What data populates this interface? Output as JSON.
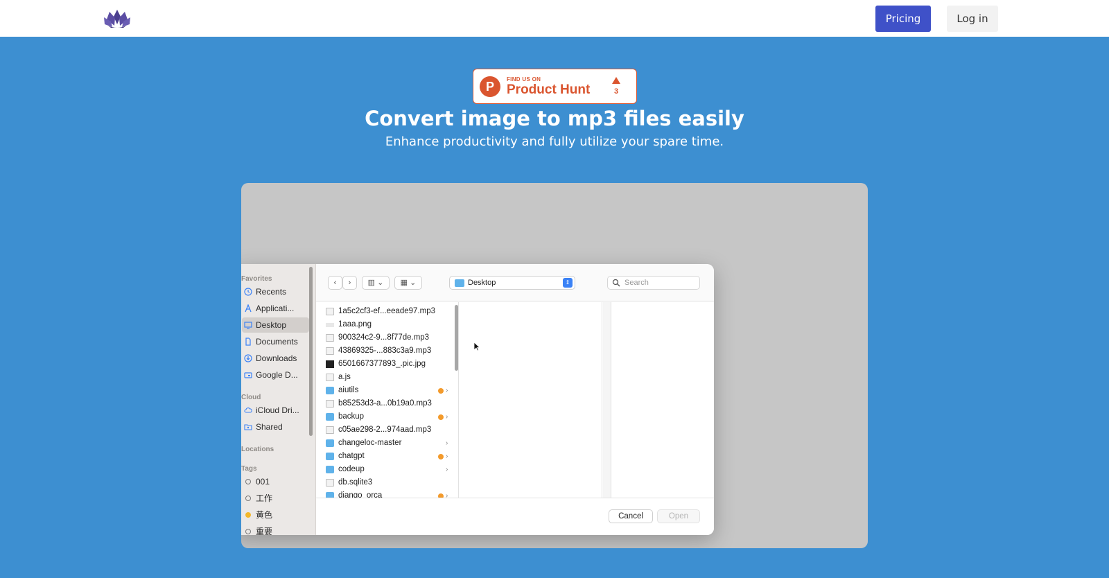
{
  "nav": {
    "pricing_label": "Pricing",
    "login_label": "Log in",
    "brand_color": "#3f51c8"
  },
  "hero": {
    "badge_small": "FIND US ON",
    "badge_big": "Product Hunt",
    "badge_count": "3",
    "title": "Convert image to mp3 files easily",
    "subtitle": "Enhance productivity and fully utilize your spare time.",
    "background_color": "#3d8fd1"
  },
  "dialog": {
    "sidebar": {
      "headings": {
        "favorites": "Favorites",
        "cloud": "Cloud",
        "locations": "Locations",
        "tags": "Tags"
      },
      "favorites": [
        {
          "label": "Recents",
          "icon": "clock-icon"
        },
        {
          "label": "Applicati...",
          "icon": "apps-icon"
        },
        {
          "label": "Desktop",
          "icon": "desktop-icon",
          "selected": true
        },
        {
          "label": "Documents",
          "icon": "document-icon"
        },
        {
          "label": "Downloads",
          "icon": "download-icon"
        },
        {
          "label": "Google D...",
          "icon": "drive-icon"
        }
      ],
      "cloud": [
        {
          "label": "iCloud Dri...",
          "icon": "cloud-icon"
        },
        {
          "label": "Shared",
          "icon": "shared-folder-icon"
        }
      ],
      "tags": [
        {
          "label": "001",
          "color": ""
        },
        {
          "label": "工作",
          "color": ""
        },
        {
          "label": "黄色",
          "color": "#f3b72b"
        },
        {
          "label": "重要",
          "color": ""
        }
      ]
    },
    "toolbar": {
      "path_label": "Desktop",
      "search_placeholder": "Search"
    },
    "files": [
      {
        "name": "1a5c2cf3-ef...eeade97.mp3",
        "type": "doc"
      },
      {
        "name": "1aaa.png",
        "type": "png"
      },
      {
        "name": "900324c2-9...8f77de.mp3",
        "type": "doc"
      },
      {
        "name": "43869325-...883c3a9.mp3",
        "type": "doc"
      },
      {
        "name": "6501667377893_.pic.jpg",
        "type": "img"
      },
      {
        "name": "a.js",
        "type": "doc"
      },
      {
        "name": "aiutils",
        "type": "folder",
        "tag": true,
        "chevron": true
      },
      {
        "name": "b85253d3-a...0b19a0.mp3",
        "type": "doc"
      },
      {
        "name": "backup",
        "type": "folder",
        "tag": true,
        "chevron": true
      },
      {
        "name": "c05ae298-2...974aad.mp3",
        "type": "doc"
      },
      {
        "name": "changeloc-master",
        "type": "folder",
        "chevron": true
      },
      {
        "name": "chatgpt",
        "type": "folder",
        "tag": true,
        "chevron": true
      },
      {
        "name": "codeup",
        "type": "folder",
        "chevron": true
      },
      {
        "name": "db.sqlite3",
        "type": "doc"
      },
      {
        "name": "django_orca",
        "type": "folder",
        "tag": true,
        "chevron": true
      }
    ],
    "footer": {
      "cancel_label": "Cancel",
      "open_label": "Open"
    }
  }
}
